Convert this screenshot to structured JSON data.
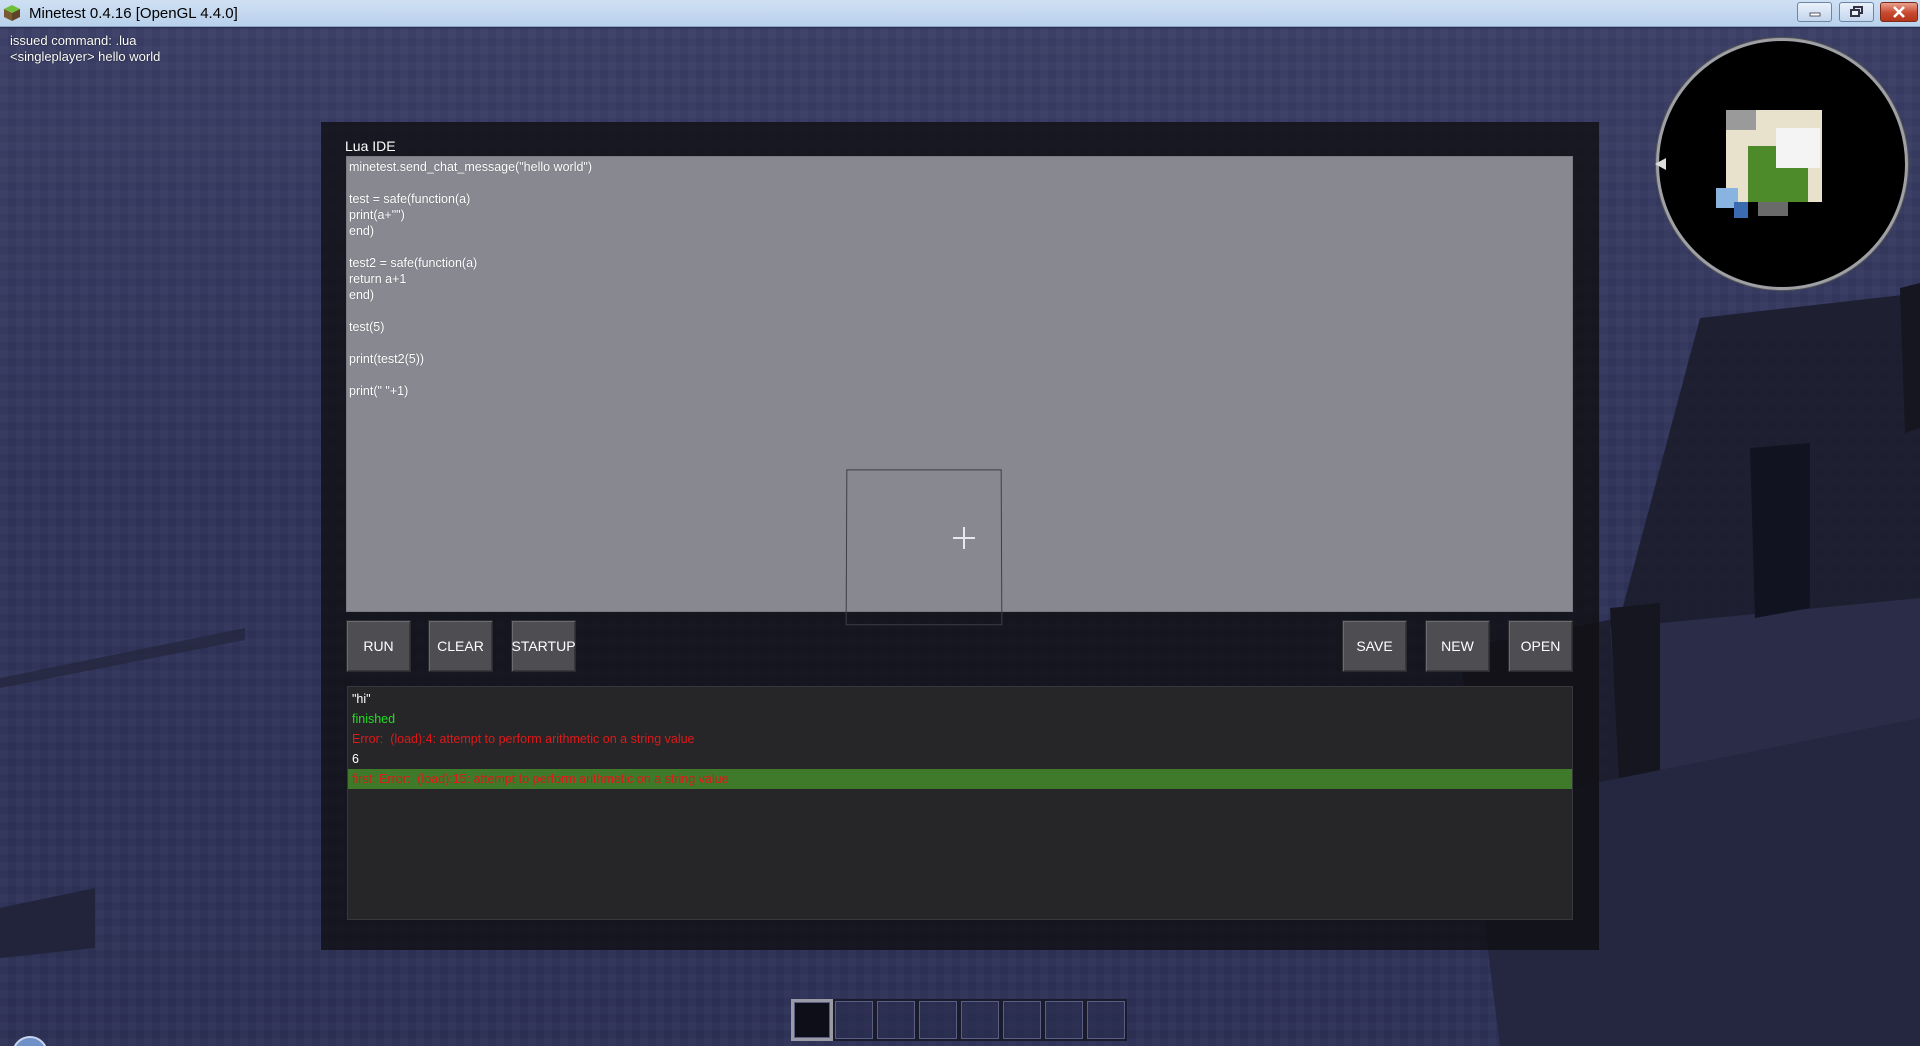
{
  "window": {
    "title": "Minetest 0.4.16 [OpenGL 4.4.0]",
    "icons": [
      "minetest-app-icon",
      "minimize-icon",
      "maximize-icon",
      "close-icon"
    ],
    "close_color": "#c74a2f"
  },
  "chat": {
    "lines": [
      "issued command: .lua",
      "<singleplayer> hello world"
    ]
  },
  "ide": {
    "title": "Lua IDE",
    "code_lines": [
      "minetest.send_chat_message(\"hello world\")",
      "",
      "test = safe(function(a)",
      "print(a+\"\")",
      "end)",
      "",
      "test2 = safe(function(a)",
      "return a+1",
      "end)",
      "",
      "test(5)",
      "",
      "print(test2(5))",
      "",
      "print(\" \"+1)"
    ],
    "buttons": {
      "run": "RUN",
      "clear": "CLEAR",
      "startup": "STARTUP",
      "save": "SAVE",
      "new": "NEW",
      "open": "OPEN"
    },
    "output_lines": [
      {
        "text": "\"hi\"",
        "color": "#ffffff"
      },
      {
        "text": "finished",
        "color": "#22dd22"
      },
      {
        "text": "Error:  (load):4: attempt to perform arithmetic on a string value",
        "color": "#e01818"
      },
      {
        "text": "6",
        "color": "#ffffff"
      },
      {
        "text": "first: Error:  (load):15: attempt to perform arithmetic on a string value",
        "color": "#e01818",
        "highlight": "#3e7a2a"
      }
    ]
  },
  "hotbar": {
    "slot_count": 8,
    "selected_index": 0
  },
  "colors": {
    "sky": "#30345a",
    "panel": "#101014",
    "code_bg": "#888891",
    "button_bg": "#4d4d52",
    "output_bg": "#262628",
    "selection": "#3e7a2a"
  }
}
